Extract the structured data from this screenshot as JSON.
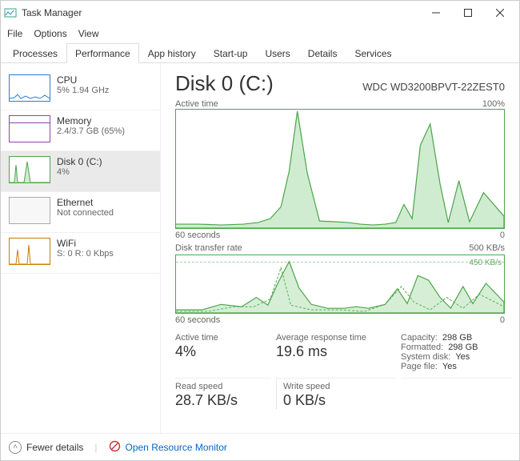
{
  "window": {
    "title": "Task Manager"
  },
  "menu": {
    "file": "File",
    "options": "Options",
    "view": "View"
  },
  "tabs": {
    "processes": "Processes",
    "performance": "Performance",
    "apphistory": "App history",
    "startup": "Start-up",
    "users": "Users",
    "details": "Details",
    "services": "Services"
  },
  "sidebar": {
    "cpu": {
      "title": "CPU",
      "sub": "5% 1.94 GHz"
    },
    "memory": {
      "title": "Memory",
      "sub": "2.4/3.7 GB (65%)"
    },
    "disk": {
      "title": "Disk 0 (C:)",
      "sub": "4%"
    },
    "eth": {
      "title": "Ethernet",
      "sub": "Not connected"
    },
    "wifi": {
      "title": "WiFi",
      "sub": "S: 0 R: 0 Kbps"
    }
  },
  "main": {
    "heading": "Disk 0 (C:)",
    "model": "WDC WD3200BPVT-22ZEST0",
    "active_label": "Active time",
    "active_max": "100%",
    "transfer_label": "Disk transfer rate",
    "transfer_max": "500 KB/s",
    "transfer_mark": "450 KB/s",
    "axis_left": "60 seconds",
    "axis_right": "0"
  },
  "stats": {
    "active_label": "Active time",
    "active_value": "4%",
    "avg_label": "Average response time",
    "avg_value": "19.6 ms",
    "read_label": "Read speed",
    "read_value": "28.7 KB/s",
    "write_label": "Write speed",
    "write_value": "0 KB/s",
    "capacity_label": "Capacity:",
    "capacity_value": "298 GB",
    "formatted_label": "Formatted:",
    "formatted_value": "298 GB",
    "sysdisk_label": "System disk:",
    "sysdisk_value": "Yes",
    "pagefile_label": "Page file:",
    "pagefile_value": "Yes"
  },
  "footer": {
    "fewer": "Fewer details",
    "orm": "Open Resource Monitor"
  },
  "chart_data": [
    {
      "type": "area",
      "title": "Active time",
      "ylabel": "%",
      "ylim": [
        0,
        100
      ],
      "xlabel": "seconds ago",
      "xlim": [
        60,
        0
      ],
      "x": [
        60,
        56,
        52,
        48,
        44,
        42,
        40,
        38,
        36,
        34,
        32,
        30,
        28,
        26,
        24,
        22,
        20,
        18,
        16,
        14,
        12,
        10,
        8,
        6,
        4,
        2,
        0
      ],
      "values": [
        4,
        4,
        3,
        4,
        5,
        8,
        18,
        48,
        100,
        46,
        6,
        6,
        5,
        4,
        3,
        4,
        5,
        20,
        8,
        70,
        90,
        38,
        5,
        40,
        6,
        30,
        10
      ]
    },
    {
      "type": "line",
      "title": "Disk transfer rate",
      "ylabel": "KB/s",
      "ylim": [
        0,
        500
      ],
      "xlabel": "seconds ago",
      "xlim": [
        60,
        0
      ],
      "series": [
        {
          "name": "Read",
          "x": [
            60,
            55,
            50,
            45,
            42,
            40,
            38,
            36,
            34,
            32,
            30,
            28,
            26,
            24,
            20,
            18,
            16,
            14,
            12,
            10,
            8,
            6,
            4,
            2,
            0
          ],
          "values": [
            20,
            20,
            50,
            40,
            120,
            60,
            250,
            430,
            200,
            60,
            30,
            30,
            40,
            30,
            50,
            180,
            60,
            300,
            260,
            120,
            40,
            200,
            60,
            240,
            80
          ]
        },
        {
          "name": "Write",
          "x": [
            60,
            50,
            45,
            40,
            38,
            36,
            34,
            30,
            25,
            20,
            15,
            12,
            10,
            8,
            6,
            4,
            2,
            0
          ],
          "values": [
            0,
            0,
            30,
            40,
            120,
            380,
            60,
            20,
            20,
            10,
            60,
            200,
            80,
            20,
            100,
            30,
            120,
            40
          ]
        }
      ]
    }
  ]
}
